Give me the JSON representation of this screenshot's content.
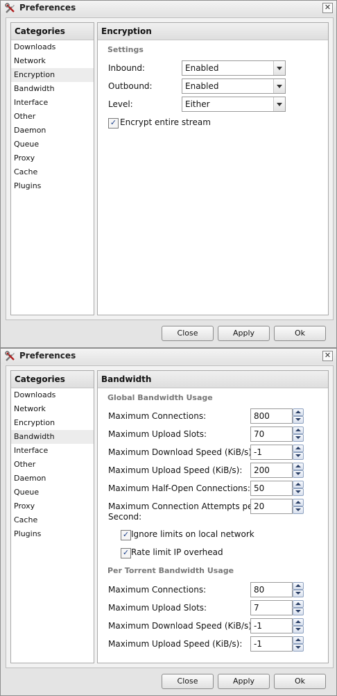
{
  "dialogs": [
    {
      "title": "Preferences",
      "categories_header": "Categories",
      "categories": [
        "Downloads",
        "Network",
        "Encryption",
        "Bandwidth",
        "Interface",
        "Other",
        "Daemon",
        "Queue",
        "Proxy",
        "Cache",
        "Plugins"
      ],
      "selected_category": "Encryption",
      "panel_title": "Encryption",
      "section": "Settings",
      "fields": [
        {
          "label": "Inbound:",
          "value": "Enabled"
        },
        {
          "label": "Outbound:",
          "value": "Enabled"
        },
        {
          "label": "Level:",
          "value": "Either"
        }
      ],
      "checkbox": {
        "label": "Encrypt entire stream",
        "checked": true
      },
      "buttons": {
        "close": "Close",
        "apply": "Apply",
        "ok": "Ok"
      }
    },
    {
      "title": "Preferences",
      "categories_header": "Categories",
      "categories": [
        "Downloads",
        "Network",
        "Encryption",
        "Bandwidth",
        "Interface",
        "Other",
        "Daemon",
        "Queue",
        "Proxy",
        "Cache",
        "Plugins"
      ],
      "selected_category": "Bandwidth",
      "panel_title": "Bandwidth",
      "global_section": "Global Bandwidth Usage",
      "global_fields": [
        {
          "label": "Maximum Connections:",
          "value": "800"
        },
        {
          "label": "Maximum Upload Slots:",
          "value": "70"
        },
        {
          "label": "Maximum Download Speed (KiB/s):",
          "value": "-1"
        },
        {
          "label": "Maximum Upload Speed (KiB/s):",
          "value": "200"
        },
        {
          "label": "Maximum Half-Open Connections:",
          "value": "50"
        },
        {
          "label_line1": "Maximum Connection Attempts per",
          "label_line2": "Second:",
          "value": "20"
        }
      ],
      "checkboxes": [
        {
          "label": "Ignore limits on local network",
          "checked": true
        },
        {
          "label": "Rate limit IP overhead",
          "checked": true
        }
      ],
      "torrent_section": "Per Torrent Bandwidth Usage",
      "torrent_fields": [
        {
          "label": "Maximum Connections:",
          "value": "80"
        },
        {
          "label": "Maximum Upload Slots:",
          "value": "7"
        },
        {
          "label": "Maximum Download Speed (KiB/s):",
          "value": "-1"
        },
        {
          "label": "Maximum Upload Speed (KiB/s):",
          "value": "-1"
        }
      ],
      "buttons": {
        "close": "Close",
        "apply": "Apply",
        "ok": "Ok"
      }
    }
  ]
}
